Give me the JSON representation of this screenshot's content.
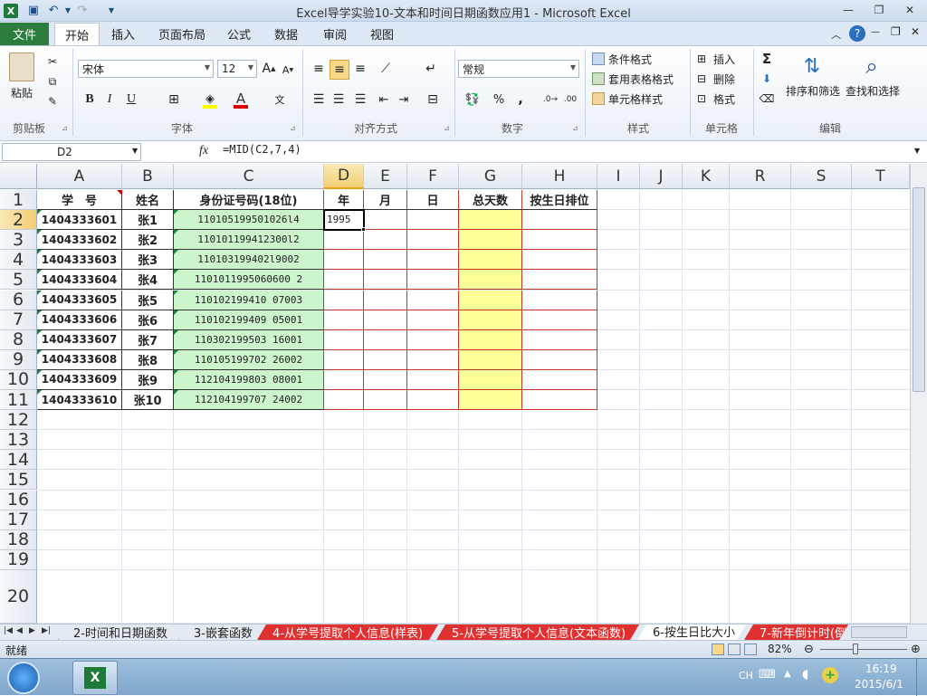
{
  "window": {
    "title": "Excel导学实验10-文本和时间日期函数应用1 - Microsoft Excel"
  },
  "ribbon_tabs": [
    "文件",
    "开始",
    "插入",
    "页面布局",
    "公式",
    "数据",
    "审阅",
    "视图"
  ],
  "clipboard": {
    "paste_label": "粘贴",
    "group_label": "剪贴板"
  },
  "font": {
    "name": "宋体",
    "size": "12",
    "group_label": "字体",
    "bold": "B",
    "italic": "I",
    "underline": "U"
  },
  "alignment": {
    "group_label": "对齐方式"
  },
  "number": {
    "format": "常规",
    "group_label": "数字",
    "percent": "%",
    "comma": ","
  },
  "styles": {
    "conditional": "条件格式",
    "table": "套用表格格式",
    "cell": "单元格样式",
    "group_label": "样式"
  },
  "cells_group": {
    "insert": "插入",
    "delete": "删除",
    "format": "格式",
    "group_label": "单元格"
  },
  "editing": {
    "sort_filter": "排序和筛选",
    "find_select": "查找和选择",
    "group_label": "编辑",
    "sigma": "Σ"
  },
  "formula_bar": {
    "name_box": "D2",
    "fx": "fx",
    "formula": "=MID(C2,7,4)"
  },
  "columns": [
    "A",
    "B",
    "C",
    "D",
    "E",
    "F",
    "G",
    "H",
    "I",
    "J",
    "K",
    "R",
    "S",
    "T"
  ],
  "rows": [
    "1",
    "2",
    "3",
    "4",
    "5",
    "6",
    "7",
    "8",
    "9",
    "10",
    "11",
    "12",
    "13",
    "14",
    "15",
    "16",
    "17",
    "18",
    "19",
    "20"
  ],
  "headers": {
    "A": "学　号",
    "B": "姓名",
    "C": "身份证号码(18位)",
    "D": "年",
    "E": "月",
    "F": "日",
    "G": "总天数",
    "H": "按生日排位"
  },
  "data_rows": [
    {
      "id": "1404333601",
      "name": "张1",
      "idcard": "110105199501026l4",
      "year": "1995"
    },
    {
      "id": "1404333602",
      "name": "张2",
      "idcard": "110101199412300l2",
      "year": ""
    },
    {
      "id": "1404333603",
      "name": "张3",
      "idcard": "110103199402l9002",
      "year": ""
    },
    {
      "id": "1404333604",
      "name": "张4",
      "idcard": "1101011995060600 2",
      "year": ""
    },
    {
      "id": "1404333605",
      "name": "张5",
      "idcard": "110102199410 07003",
      "year": ""
    },
    {
      "id": "1404333606",
      "name": "张6",
      "idcard": "110102199409 05001",
      "year": ""
    },
    {
      "id": "1404333607",
      "name": "张7",
      "idcard": "110302199503 16001",
      "year": ""
    },
    {
      "id": "1404333608",
      "name": "张8",
      "idcard": "110105199702 26002",
      "year": ""
    },
    {
      "id": "1404333609",
      "name": "张9",
      "idcard": "112104199803 08001",
      "year": ""
    },
    {
      "id": "1404333610",
      "name": "张10",
      "idcard": "112104199707 24002",
      "year": ""
    }
  ],
  "sheet_tabs": [
    "2-时间和日期函数",
    "3-嵌套函数",
    "4-从学号提取个人信息(样表)",
    "5-从学号提取个人信息(文本函数)",
    "6-按生日比大小",
    "7-新年倒计时(倒"
  ],
  "active_sheet": "6-按生日比大小",
  "status": {
    "ready": "就绪",
    "zoom": "82%"
  },
  "taskbar": {
    "lang": "CH",
    "time": "16:19",
    "date": "2015/6/1"
  },
  "colors": {
    "file_tab": "#2c7c3b",
    "id_fill": "#ccf5cc",
    "total_fill": "#ffff99",
    "border_red": "#c0392b",
    "tab_red": "#e03030"
  }
}
